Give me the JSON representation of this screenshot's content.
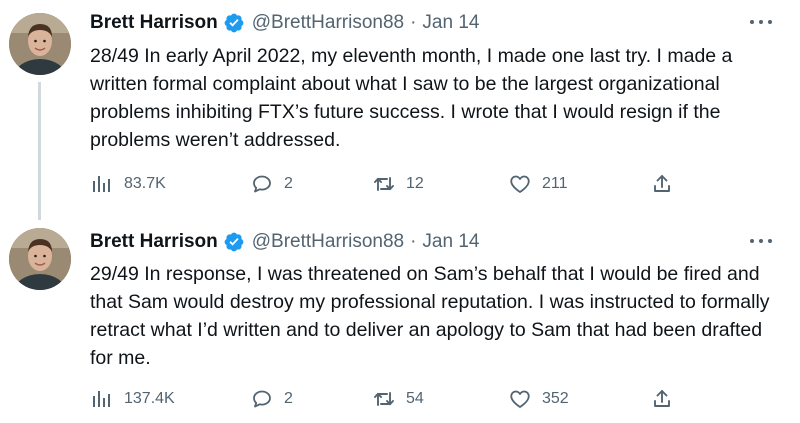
{
  "tweets": [
    {
      "author": {
        "name": "Brett Harrison",
        "handle": "@BrettHarrison88",
        "verified": true
      },
      "separator": "·",
      "date": "Jan 14",
      "text": "28/49 In early April 2022, my eleventh month, I made one last try. I made a written formal complaint about what I saw to be the largest organizational problems inhibiting FTX’s future success. I wrote that I would resign if the problems weren’t addressed.",
      "stats": {
        "views": "83.7K",
        "replies": "2",
        "retweets": "12",
        "likes": "211"
      }
    },
    {
      "author": {
        "name": "Brett Harrison",
        "handle": "@BrettHarrison88",
        "verified": true
      },
      "separator": "·",
      "date": "Jan 14",
      "text": "29/49 In response, I was threatened on Sam’s behalf that I would be fired and that Sam would destroy my professional reputation. I was instructed to formally retract what I’d written and to deliver an apology to Sam that had been drafted for me.",
      "stats": {
        "views": "137.4K",
        "replies": "2",
        "retweets": "54",
        "likes": "352"
      }
    }
  ],
  "icons": {
    "more": "more-horizontal-icon",
    "views": "analytics-icon",
    "reply": "reply-icon",
    "retweet": "retweet-icon",
    "like": "heart-icon",
    "share": "share-icon",
    "verified": "verified-badge-icon"
  },
  "colors": {
    "text": "#0f1419",
    "secondary": "#536471",
    "verified": "#1d9bf0",
    "thread_line": "#cfd9de"
  }
}
